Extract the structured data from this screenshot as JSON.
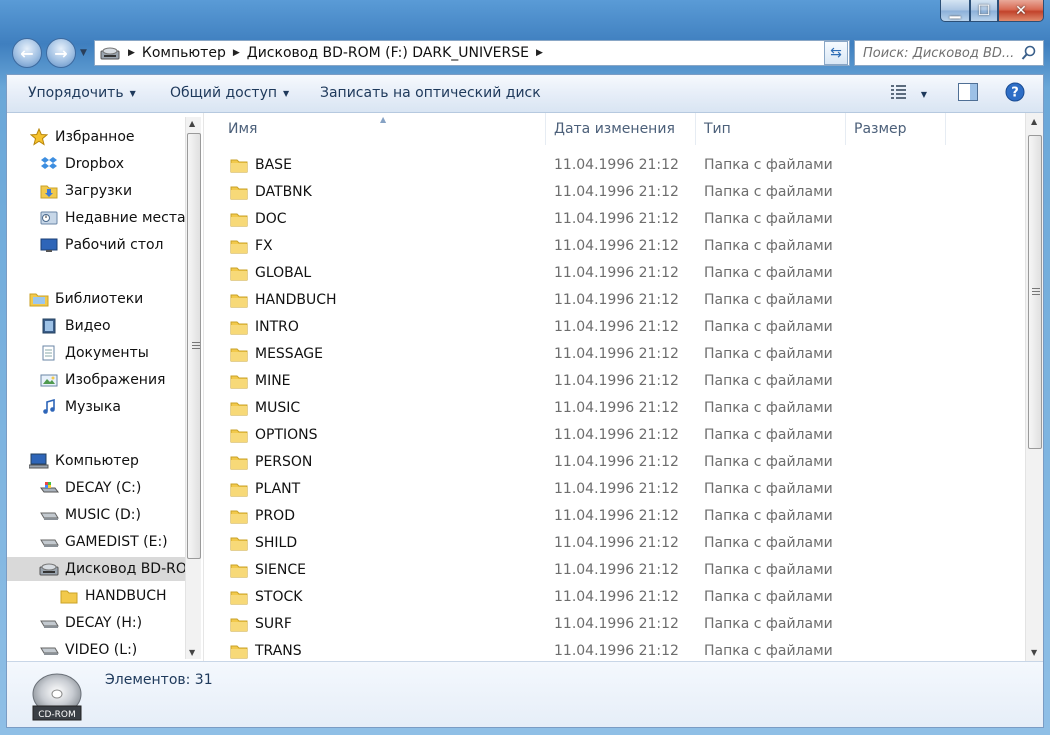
{
  "window": {
    "controls": {
      "minimize": "▁",
      "maximize": "☐",
      "close": "✕"
    }
  },
  "nav": {
    "breadcrumb": [
      "Компьютер",
      "Дисковод BD-ROM (F:) DARK_UNIVERSE"
    ],
    "search_placeholder": "Поиск: Дисковод BD..."
  },
  "toolbar": {
    "organize": "Упорядочить",
    "share": "Общий доступ",
    "burn": "Записать на оптический диск"
  },
  "sidebar": {
    "groups": [
      {
        "label": "Избранное",
        "icon": "star-icon",
        "items": [
          {
            "label": "Dropbox",
            "icon": "dropbox-icon"
          },
          {
            "label": "Загрузки",
            "icon": "downloads-folder-icon"
          },
          {
            "label": "Недавние места",
            "icon": "recent-places-icon"
          },
          {
            "label": "Рабочий стол",
            "icon": "desktop-icon"
          }
        ]
      },
      {
        "label": "Библиотеки",
        "icon": "libraries-icon",
        "items": [
          {
            "label": "Видео",
            "icon": "video-library-icon"
          },
          {
            "label": "Документы",
            "icon": "documents-library-icon"
          },
          {
            "label": "Изображения",
            "icon": "pictures-library-icon"
          },
          {
            "label": "Музыка",
            "icon": "music-library-icon"
          }
        ]
      },
      {
        "label": "Компьютер",
        "icon": "computer-icon",
        "items": [
          {
            "label": "DECAY (C:)",
            "icon": "system-drive-icon"
          },
          {
            "label": "MUSIC (D:)",
            "icon": "hard-drive-icon"
          },
          {
            "label": "GAMEDIST (E:)",
            "icon": "hard-drive-icon"
          },
          {
            "label": "Дисковод BD-ROM (F:) DARK_UNIVERSE",
            "icon": "bd-rom-drive-icon",
            "selected": true
          },
          {
            "label": "HANDBUCH",
            "icon": "folder-icon",
            "indent": true
          },
          {
            "label": "DECAY (H:)",
            "icon": "hard-drive-icon"
          },
          {
            "label": "VIDEO (L:)",
            "icon": "hard-drive-icon"
          }
        ]
      }
    ]
  },
  "list": {
    "columns": {
      "name": "Имя",
      "date": "Дата изменения",
      "type": "Тип",
      "size": "Размер"
    },
    "rows": [
      {
        "name": "BASE",
        "date": "11.04.1996 21:12",
        "type": "Папка с файлами"
      },
      {
        "name": "DATBNK",
        "date": "11.04.1996 21:12",
        "type": "Папка с файлами"
      },
      {
        "name": "DOC",
        "date": "11.04.1996 21:12",
        "type": "Папка с файлами"
      },
      {
        "name": "FX",
        "date": "11.04.1996 21:12",
        "type": "Папка с файлами"
      },
      {
        "name": "GLOBAL",
        "date": "11.04.1996 21:12",
        "type": "Папка с файлами"
      },
      {
        "name": "HANDBUCH",
        "date": "11.04.1996 21:12",
        "type": "Папка с файлами"
      },
      {
        "name": "INTRO",
        "date": "11.04.1996 21:12",
        "type": "Папка с файлами"
      },
      {
        "name": "MESSAGE",
        "date": "11.04.1996 21:12",
        "type": "Папка с файлами"
      },
      {
        "name": "MINE",
        "date": "11.04.1996 21:12",
        "type": "Папка с файлами"
      },
      {
        "name": "MUSIC",
        "date": "11.04.1996 21:12",
        "type": "Папка с файлами"
      },
      {
        "name": "OPTIONS",
        "date": "11.04.1996 21:12",
        "type": "Папка с файлами"
      },
      {
        "name": "PERSON",
        "date": "11.04.1996 21:12",
        "type": "Папка с файлами"
      },
      {
        "name": "PLANT",
        "date": "11.04.1996 21:12",
        "type": "Папка с файлами"
      },
      {
        "name": "PROD",
        "date": "11.04.1996 21:12",
        "type": "Папка с файлами"
      },
      {
        "name": "SHILD",
        "date": "11.04.1996 21:12",
        "type": "Папка с файлами"
      },
      {
        "name": "SIENCE",
        "date": "11.04.1996 21:12",
        "type": "Папка с файлами"
      },
      {
        "name": "STOCK",
        "date": "11.04.1996 21:12",
        "type": "Папка с файлами"
      },
      {
        "name": "SURF",
        "date": "11.04.1996 21:12",
        "type": "Папка с файлами"
      },
      {
        "name": "TRANS",
        "date": "11.04.1996 21:12",
        "type": "Папка с файлами"
      }
    ]
  },
  "details": {
    "count_text": "Элементов: 31",
    "drive_icon_text": "CD-ROM"
  },
  "colors": {
    "folder": "#f2c94c",
    "accent": "#1e395b",
    "selection": "#d9d9d9"
  }
}
